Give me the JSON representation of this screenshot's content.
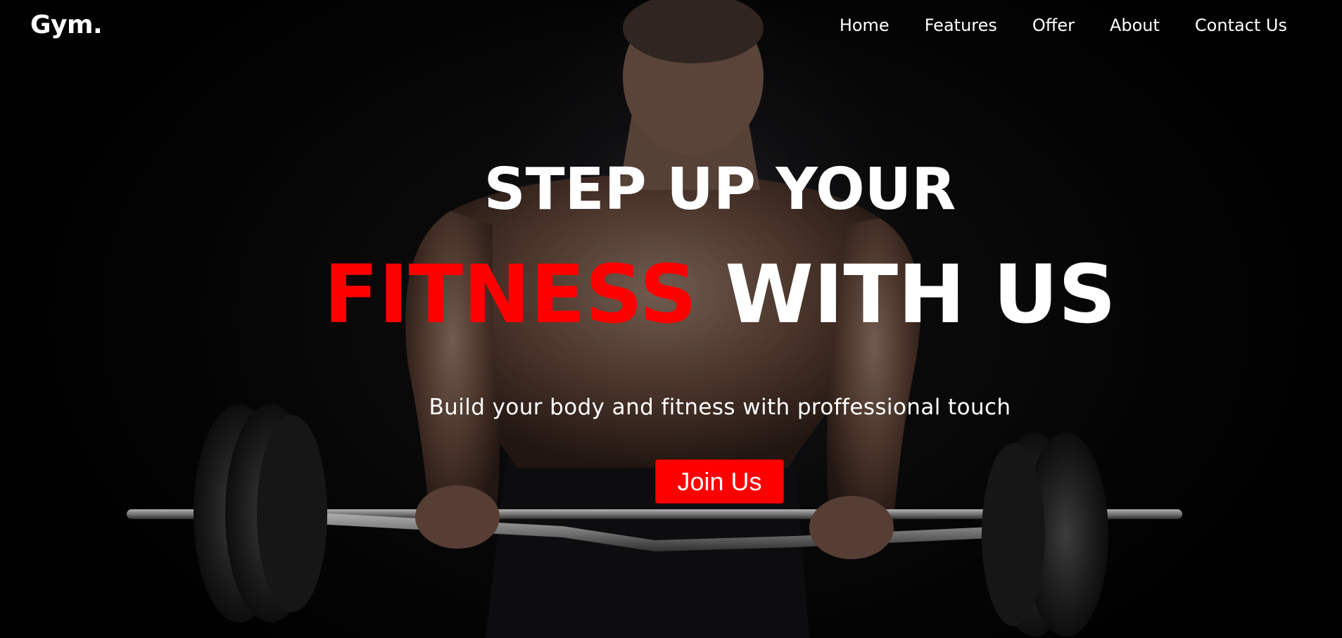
{
  "navbar": {
    "logo": "Gym.",
    "links": [
      {
        "label": "Home"
      },
      {
        "label": "Features"
      },
      {
        "label": "Offer"
      },
      {
        "label": "About"
      },
      {
        "label": "Contact Us"
      }
    ]
  },
  "hero": {
    "headline_line1": "STEP UP YOUR",
    "headline_accent": "FITNESS",
    "headline_rest": " WITH US",
    "subtitle": "Build your body and fitness with proffessional touch",
    "cta_label": "Join Us"
  },
  "colors": {
    "accent": "#ff0000",
    "text": "#ffffff",
    "background": "#050505"
  }
}
